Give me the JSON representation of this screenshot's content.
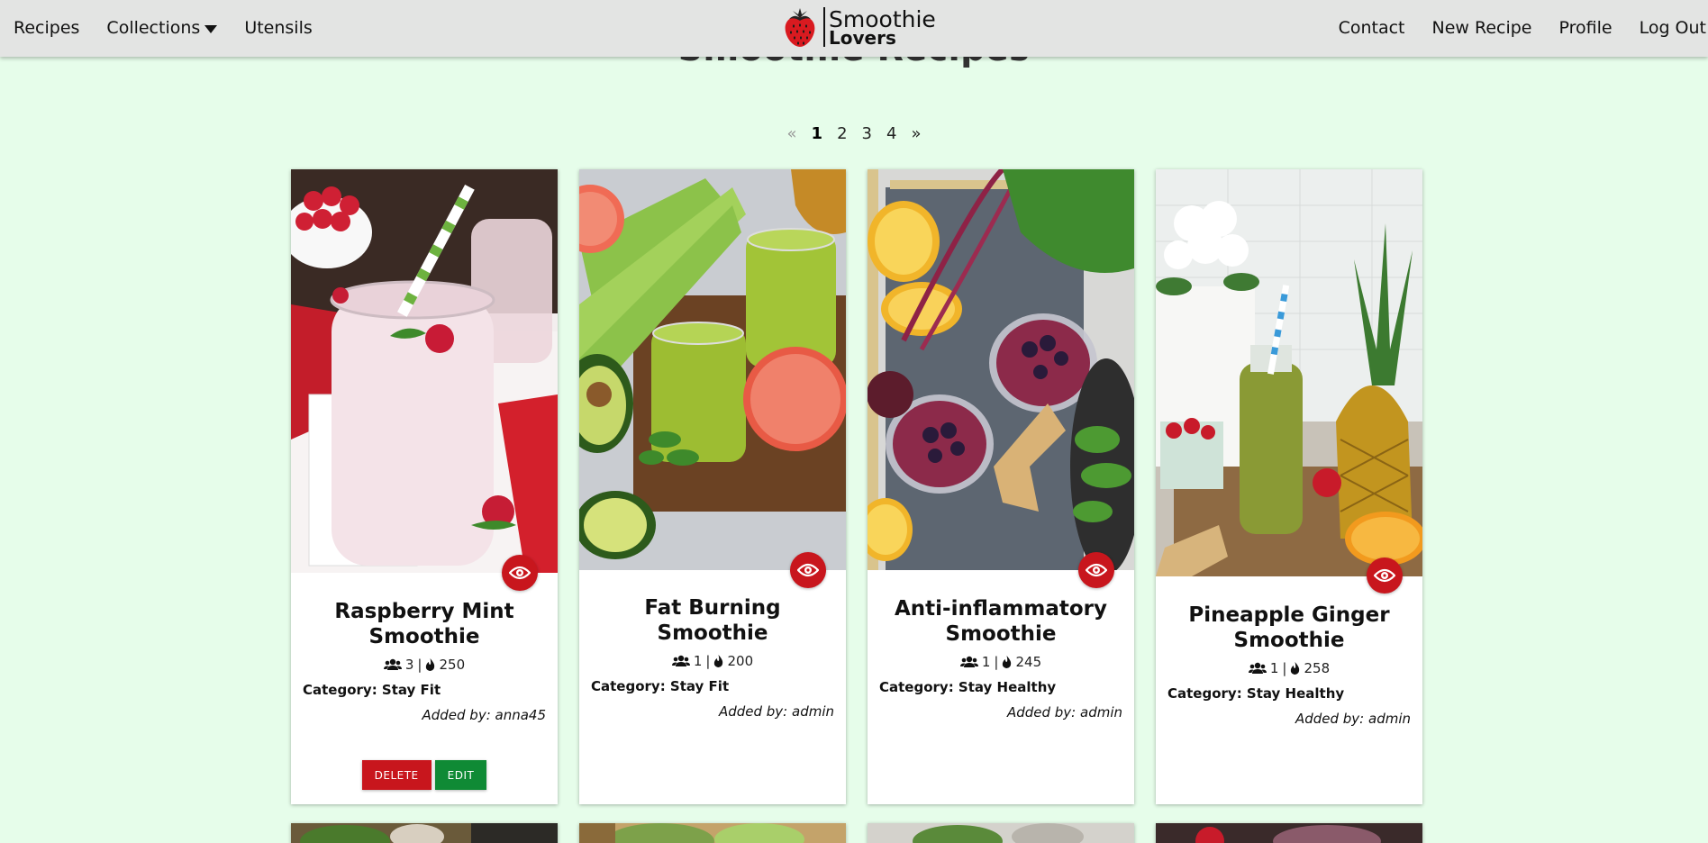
{
  "nav": {
    "left": [
      {
        "label": "Recipes"
      },
      {
        "label": "Collections"
      },
      {
        "label": "Utensils"
      }
    ],
    "right": [
      {
        "label": "Contact"
      },
      {
        "label": "New Recipe"
      },
      {
        "label": "Profile"
      },
      {
        "label": "Log Out"
      }
    ],
    "brand": {
      "line1": "Smoothie",
      "line2": "Lovers"
    }
  },
  "page": {
    "title": "Smoothie Recipes"
  },
  "pagination": {
    "prev": "«",
    "pages": [
      "1",
      "2",
      "3",
      "4"
    ],
    "next": "»",
    "active": "1"
  },
  "labels": {
    "category_prefix": "Category: ",
    "added_prefix": "Added by: ",
    "delete": "DELETE",
    "edit": "EDIT",
    "sep": "|"
  },
  "colors": {
    "accent_red": "#c8161d",
    "accent_green": "#0f8a35",
    "background": "#e6fdea",
    "navbar": "#e3e4e3"
  },
  "recipes": [
    {
      "title": "Raspberry Mint Smoothie",
      "servings": "3",
      "calories": "250",
      "category": "Stay Fit",
      "added_by": "anna45",
      "editable": true
    },
    {
      "title": "Fat Burning Smoothie",
      "servings": "1",
      "calories": "200",
      "category": "Stay Fit",
      "added_by": "admin",
      "editable": false
    },
    {
      "title": "Anti-inflammatory Smoothie",
      "servings": "1",
      "calories": "245",
      "category": "Stay Healthy",
      "added_by": "admin",
      "editable": false
    },
    {
      "title": "Pineapple Ginger Smoothie",
      "servings": "1",
      "calories": "258",
      "category": "Stay Healthy",
      "added_by": "admin",
      "editable": false
    }
  ],
  "icons": {
    "view": "eye-icon",
    "servings": "users-icon",
    "calories": "fire-icon",
    "dropdown": "caret-down-icon",
    "logo": "strawberry-icon"
  }
}
